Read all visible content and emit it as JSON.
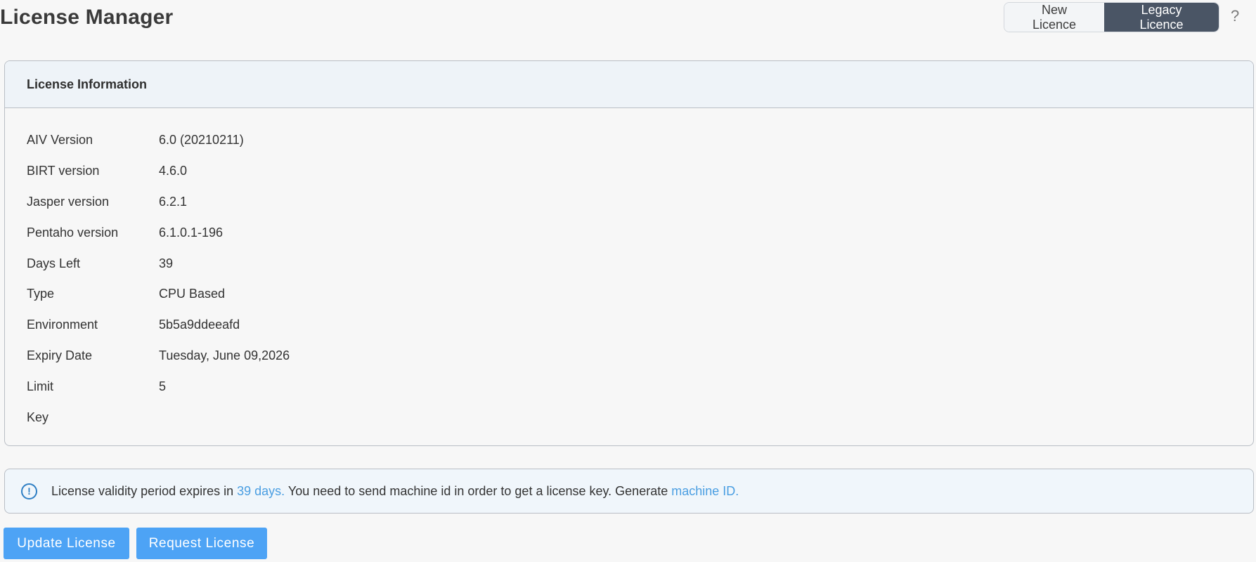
{
  "header": {
    "title": "License Manager",
    "toggle": {
      "new_label": "New Licence",
      "legacy_label": "Legacy Licence",
      "active": "legacy"
    },
    "help_glyph": "?"
  },
  "card": {
    "title": "License Information",
    "rows": [
      {
        "label": "AIV Version",
        "value": "6.0 (20210211)"
      },
      {
        "label": "BIRT version",
        "value": "4.6.0"
      },
      {
        "label": "Jasper version",
        "value": "6.2.1"
      },
      {
        "label": "Pentaho version",
        "value": "6.1.0.1-196"
      },
      {
        "label": "Days Left",
        "value": "39"
      },
      {
        "label": "Type",
        "value": "CPU Based"
      },
      {
        "label": "Environment",
        "value": "5b5a9ddeeafd"
      },
      {
        "label": "Expiry Date",
        "value": "Tuesday, June 09,2026"
      },
      {
        "label": "Limit",
        "value": "5"
      },
      {
        "label": "Key",
        "value": ""
      }
    ]
  },
  "alert": {
    "icon": "info-circle-icon",
    "text_before": "License validity period expires in ",
    "days_link": "39 days.",
    "text_middle": " You need to send machine id in order to get a license key. Generate ",
    "machine_link": "machine ID."
  },
  "actions": {
    "update_label": "Update License",
    "request_label": "Request License"
  },
  "colors": {
    "accent": "#4da3f5",
    "toggle_active": "#4a5565",
    "link": "#4a9ee2",
    "alert_icon": "#2f7fc4"
  }
}
